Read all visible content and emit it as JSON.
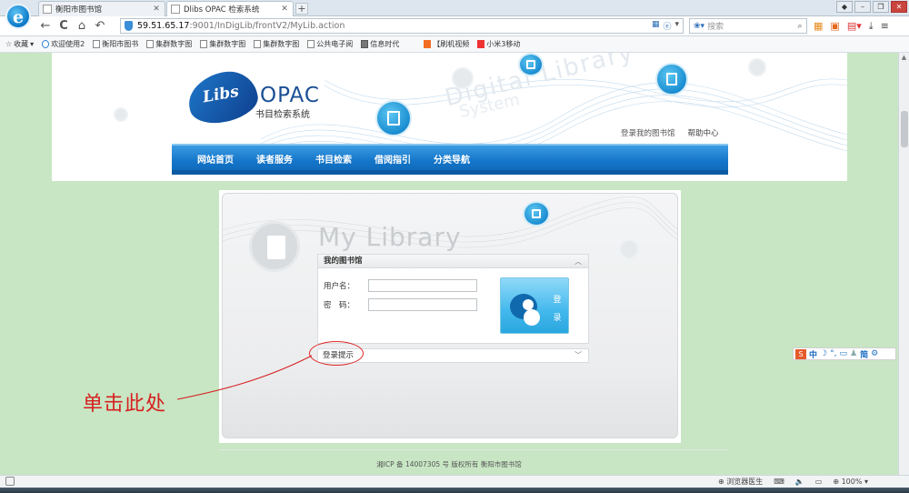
{
  "browser": {
    "logo_letter": "e",
    "tabs": [
      {
        "label": "衡阳市图书馆",
        "active": false
      },
      {
        "label": "Dlibs OPAC 检索系统",
        "active": true
      }
    ],
    "new_tab": "+",
    "window_controls": [
      "◆",
      "–",
      "❐",
      "✕"
    ],
    "nav": {
      "back": "←",
      "refresh": "C",
      "home": "⌂",
      "undo": "↶"
    },
    "url_host": "59.51.65.17",
    "url_path": ":9001/InDigLib/frontV2/MyLib.action",
    "search_placeholder": "搜索",
    "bookmarks": [
      {
        "label": "收藏",
        "icon": "star-icon"
      },
      {
        "label": "欢迎使用2",
        "icon": "ie-icon"
      },
      {
        "label": "衡阳市图书",
        "icon": "page-icon"
      },
      {
        "label": "集群数字图",
        "icon": "page-icon"
      },
      {
        "label": "集群数字图",
        "icon": "page-icon"
      },
      {
        "label": "集群数字图",
        "icon": "page-icon"
      },
      {
        "label": "公共电子阅",
        "icon": "chart-icon"
      },
      {
        "label": "信息时代",
        "icon": "grey-icon"
      },
      {
        "label": "【刷机视频",
        "icon": "mi-icon"
      },
      {
        "label": "小米3移动",
        "icon": "red-icon"
      }
    ]
  },
  "header": {
    "logo_libs": "Libs",
    "logo_opac": "OPAC",
    "logo_subtitle": "书目检索系统",
    "watermark_1": "Digital Library",
    "watermark_2": "System",
    "links": {
      "my_library": "登录我的图书馆",
      "help": "帮助中心"
    }
  },
  "menu": {
    "items": [
      "网站首页",
      "读者服务",
      "书目检索",
      "借阅指引",
      "分类导航"
    ]
  },
  "panel": {
    "title": "My Library",
    "box_title": "我的图书馆",
    "username_label": "用户名：",
    "username_value": "",
    "password_label": "密　码：",
    "password_value": "",
    "login_button": "登录",
    "hint_label": "登录提示",
    "chevron_up": "︿",
    "chevron_down": "﹀"
  },
  "annotation": {
    "text": "单击此处",
    "color": "#d62020"
  },
  "footer": {
    "text": "湘ICP 备 14007305 号 版权所有 衡阳市图书馆"
  },
  "ime": {
    "mode": "中",
    "simplified": "简"
  },
  "status": {
    "health": "浏览器医生",
    "zoom": "100%"
  },
  "colors": {
    "menu_blue": "#1475c8",
    "page_bg": "#c8e6c4",
    "login_button": "#43b8ec"
  }
}
